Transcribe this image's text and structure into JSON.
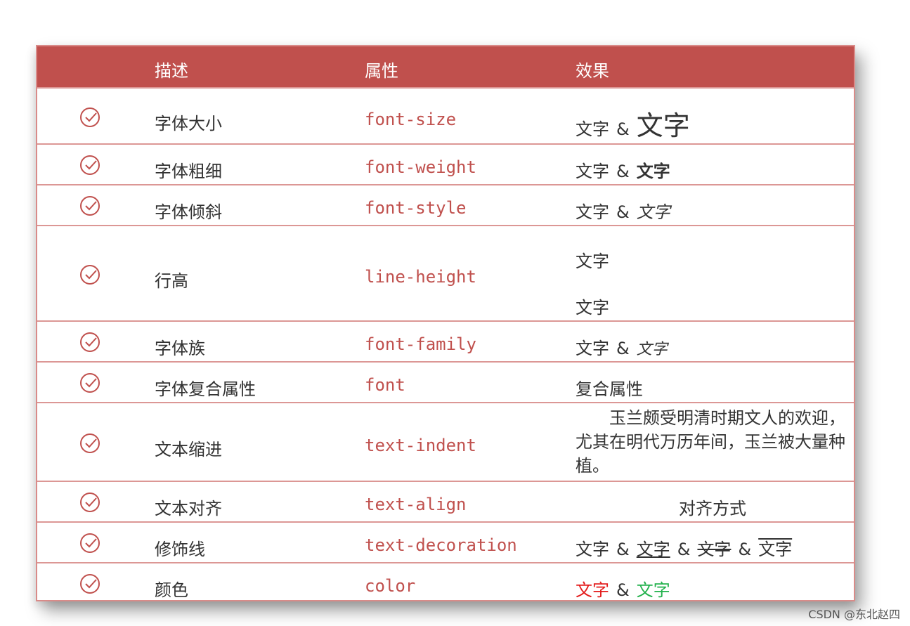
{
  "header": {
    "col_desc": "描述",
    "col_prop": "属性",
    "col_effect": "效果"
  },
  "rows": [
    {
      "desc": "字体大小",
      "prop": "font-size",
      "effect": {
        "a": "文字",
        "amp": "&",
        "b": "文字"
      }
    },
    {
      "desc": "字体粗细",
      "prop": "font-weight",
      "effect": {
        "a": "文字",
        "amp": "&",
        "b": "文字"
      }
    },
    {
      "desc": "字体倾斜",
      "prop": "font-style",
      "effect": {
        "a": "文字",
        "amp": "&",
        "b": "文字"
      }
    },
    {
      "desc": "行高",
      "prop": "line-height",
      "effect": {
        "line1": "文字",
        "line2": "文字"
      }
    },
    {
      "desc": "字体族",
      "prop": "font-family",
      "effect": {
        "a": "文字",
        "amp": "&",
        "b": "文字"
      }
    },
    {
      "desc": "字体复合属性",
      "prop": "font",
      "effect": {
        "text": "复合属性"
      }
    },
    {
      "desc": "文本缩进",
      "prop": "text-indent",
      "effect": {
        "text": "玉兰颇受明清时期文人的欢迎，尤其在明代万历年间，玉兰被大量种植。"
      }
    },
    {
      "desc": "文本对齐",
      "prop": "text-align",
      "effect": {
        "text": "对齐方式"
      }
    },
    {
      "desc": "修饰线",
      "prop": "text-decoration",
      "effect": {
        "a": "文字",
        "b": "文字",
        "c": "文字",
        "d": "文字",
        "amp": "&"
      }
    },
    {
      "desc": "颜色",
      "prop": "color",
      "effect": {
        "a": "文字",
        "amp": "&",
        "b": "文字"
      }
    }
  ],
  "icons": {
    "row_marker": "check-circle-icon"
  },
  "colors": {
    "header_bg": "#c0504d",
    "prop_text": "#c0504d",
    "red": "#e31b1b",
    "green": "#22b14c"
  },
  "watermark": "CSDN @东北赵四"
}
